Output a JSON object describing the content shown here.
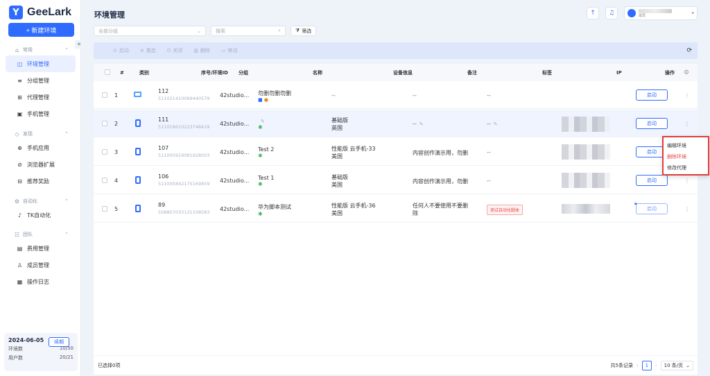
{
  "app": {
    "logo_text": "GeeLark",
    "page_title": "环境管理"
  },
  "sidebar": {
    "new_env_label": "+ 新建环境",
    "groups": [
      {
        "title": "常用",
        "items": [
          "环境管理",
          "分组管理",
          "代理管理",
          "手机管理"
        ]
      },
      {
        "title": "发现",
        "items": [
          "手机应用",
          "浏览器扩展",
          "推荐奖励"
        ]
      },
      {
        "title": "自动化",
        "items": [
          "TK自动化"
        ]
      },
      {
        "title": "团队",
        "items": [
          "费用管理",
          "成员管理",
          "操作日志"
        ]
      }
    ],
    "footer": {
      "date": "2024-06-05",
      "renew": "续期",
      "env_label": "环境数",
      "env_value": "10/50",
      "user_label": "用户数",
      "user_value": "20/21"
    }
  },
  "header": {
    "user_role": "成员"
  },
  "filters": {
    "group_placeholder": "全部分组",
    "search_placeholder": "搜索",
    "filter_label": "筛选"
  },
  "toolbar": {
    "start": "启动",
    "restart": "重启",
    "close": "关闭",
    "delete": "删除",
    "move": "移动"
  },
  "table": {
    "headers": {
      "num": "#",
      "type": "类别",
      "id": "序号/环境ID",
      "group": "分组",
      "name": "名称",
      "device": "设备信息",
      "note": "备注",
      "tag": "标签",
      "ip": "IP",
      "action": "操作"
    },
    "rows": [
      {
        "num": "1",
        "seq": "112",
        "env_id": "511021410089440579",
        "group": "42studio...",
        "name": "勿删勿删勿删",
        "device": "--",
        "device2": "",
        "note": "--",
        "tag": "--",
        "start": "启动"
      },
      {
        "num": "2",
        "seq": "111",
        "env_id": "511018610223748419",
        "group": "42studio...",
        "name": "",
        "device": "基础版",
        "device2": "英国",
        "note": "--",
        "tag": "--",
        "start": "启动"
      },
      {
        "num": "3",
        "seq": "107",
        "env_id": "511005919081928003",
        "group": "42studio...",
        "name": "Test 2",
        "device": "性能版 云手机-33",
        "device2": "美国",
        "note": "内容创作演示用，勿删",
        "tag": "--",
        "start": "启动"
      },
      {
        "num": "4",
        "seq": "106",
        "env_id": "511005842175169859",
        "group": "42studio...",
        "name": "Test 1",
        "device": "基础版",
        "device2": "美国",
        "note": "内容创作演示用，勿删",
        "tag": "--",
        "start": "启动"
      },
      {
        "num": "5",
        "seq": "89",
        "env_id": "508807033131108583",
        "group": "42studio...",
        "name": "华为脚本测试",
        "device": "性能版 云手机-36",
        "device2": "美国",
        "note": "任何人不要使用不要删",
        "note2": "除",
        "tag": "测试自动化脚本",
        "start": "启动"
      }
    ]
  },
  "context_menu": {
    "edit": "编辑环境",
    "delete": "删除环境",
    "proxy": "修改代理"
  },
  "footer": {
    "selected": "已选择0项",
    "total": "共5条记录",
    "page": "1",
    "page_size": "10 条/页"
  }
}
